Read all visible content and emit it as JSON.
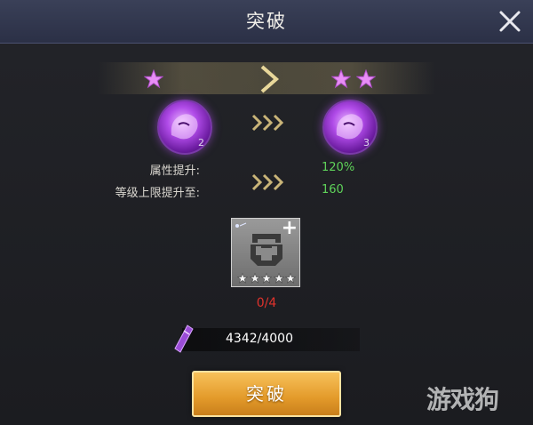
{
  "window": {
    "title": "突破"
  },
  "close": {
    "icon": "close-icon"
  },
  "breakthrough": {
    "from_stars": 1,
    "to_stars": 2,
    "from_hero_level": "2",
    "to_hero_level": "3",
    "hero_icon": "purple-lion-icon"
  },
  "stats": [
    {
      "label": "属性提升:",
      "value": "120%"
    },
    {
      "label": "等级上限提升至:",
      "value": "160"
    }
  ],
  "material": {
    "icon": "armor-material-icon",
    "stars": 5,
    "count": "0/4",
    "add_icon": "plus-icon"
  },
  "resource": {
    "icon": "purple-crystal-icon",
    "amount": "4342/4000"
  },
  "action": {
    "label": "突破"
  },
  "watermark": "游戏狗",
  "colors": {
    "titlebar": "#2b3046",
    "value_green": "#5fd35a",
    "count_red": "#e0322c",
    "button_gold": "#e39a2a",
    "star_pink": "#e88ef5"
  }
}
